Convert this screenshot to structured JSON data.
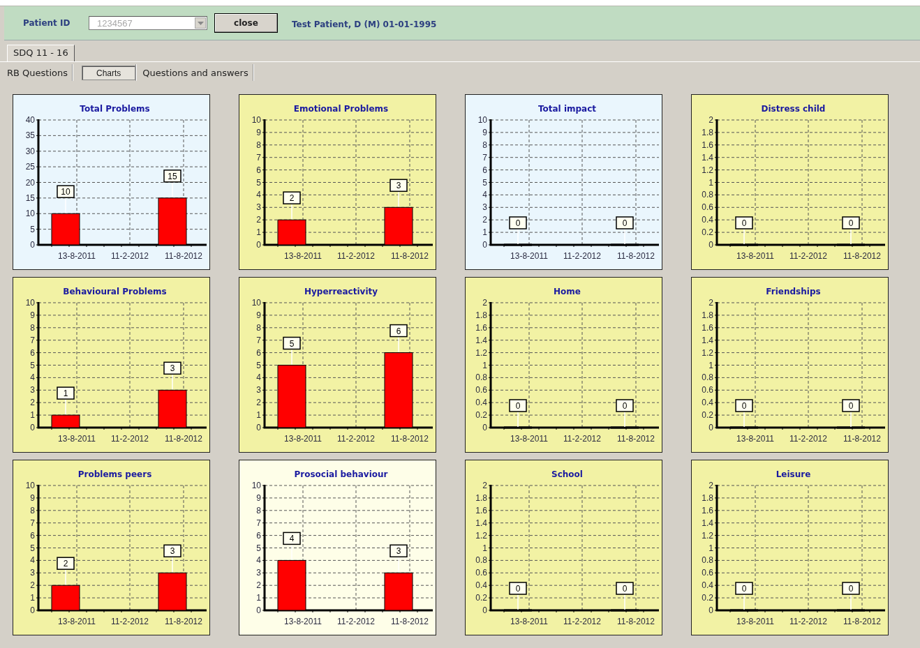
{
  "header": {
    "patient_id_label": "Patient ID",
    "patient_id": {
      "value": "1234567",
      "disabled": true
    },
    "close_button": "close",
    "patient_info": "Test Patient, D (M) 01-01-1995"
  },
  "tabs": [
    {
      "label": "SDQ 11 - 16",
      "selected": true
    }
  ],
  "subtabs": [
    {
      "label": "RB Questions",
      "selected": false
    },
    {
      "label": "Charts",
      "selected": true
    },
    {
      "label": "Questions and answers",
      "selected": false
    }
  ],
  "charts": [
    {
      "color": "#eaf6fd",
      "chart_data": {
        "type": "bar",
        "title": "Total Problems",
        "categories": [
          "13-8-2011",
          "11-2-2012",
          "11-8-2012"
        ],
        "series": [
          {
            "color": "#ff0000",
            "values": [
              10,
              null,
              15
            ]
          }
        ],
        "ylim": [
          0,
          40
        ],
        "yticks": [
          0,
          5,
          10,
          15,
          20,
          25,
          30,
          35,
          40
        ],
        "grid": true,
        "data_labels": true
      }
    },
    {
      "color": "#f2f2a4",
      "chart_data": {
        "type": "bar",
        "title": "Emotional Problems",
        "categories": [
          "13-8-2011",
          "11-2-2012",
          "11-8-2012"
        ],
        "series": [
          {
            "color": "#ff0000",
            "values": [
              2,
              null,
              3
            ]
          }
        ],
        "ylim": [
          0,
          10
        ],
        "yticks": [
          0,
          1,
          2,
          3,
          4,
          5,
          6,
          7,
          8,
          9,
          10
        ],
        "grid": true,
        "data_labels": true
      }
    },
    {
      "color": "#eaf6fd",
      "chart_data": {
        "type": "bar",
        "title": "Total impact",
        "categories": [
          "13-8-2011",
          "11-2-2012",
          "11-8-2012"
        ],
        "series": [
          {
            "values": [
              0,
              null,
              0
            ]
          }
        ],
        "ylim": [
          0,
          10
        ],
        "yticks": [
          0,
          1,
          2,
          3,
          4,
          5,
          6,
          7,
          8,
          9,
          10
        ],
        "grid": true,
        "data_labels": true
      }
    },
    {
      "color": "#f2f2a4",
      "chart_data": {
        "type": "bar",
        "title": "Distress child",
        "categories": [
          "13-8-2011",
          "11-2-2012",
          "11-8-2012"
        ],
        "series": [
          {
            "values": [
              0,
              null,
              0
            ]
          }
        ],
        "ylim": [
          0,
          2
        ],
        "yticks": [
          0,
          0.2,
          0.4,
          0.6,
          0.8,
          1,
          1.2,
          1.4,
          1.6,
          1.8,
          2
        ],
        "grid": true,
        "data_labels": true
      }
    },
    {
      "color": "#f2f2a4",
      "chart_data": {
        "type": "bar",
        "title": "Behavioural Problems",
        "categories": [
          "13-8-2011",
          "11-2-2012",
          "11-8-2012"
        ],
        "series": [
          {
            "color": "#ff0000",
            "values": [
              1,
              null,
              3
            ]
          }
        ],
        "ylim": [
          0,
          10
        ],
        "yticks": [
          0,
          1,
          2,
          3,
          4,
          5,
          6,
          7,
          8,
          9,
          10
        ],
        "grid": true,
        "data_labels": true
      }
    },
    {
      "color": "#f2f2a4",
      "chart_data": {
        "type": "bar",
        "title": "Hyperreactivity",
        "categories": [
          "13-8-2011",
          "11-2-2012",
          "11-8-2012"
        ],
        "series": [
          {
            "color": "#ff0000",
            "values": [
              5,
              null,
              6
            ]
          }
        ],
        "ylim": [
          0,
          10
        ],
        "yticks": [
          0,
          1,
          2,
          3,
          4,
          5,
          6,
          7,
          8,
          9,
          10
        ],
        "grid": true,
        "data_labels": true
      }
    },
    {
      "color": "#f2f2a4",
      "chart_data": {
        "type": "bar",
        "title": "Home",
        "categories": [
          "13-8-2011",
          "11-2-2012",
          "11-8-2012"
        ],
        "series": [
          {
            "values": [
              0,
              null,
              0
            ]
          }
        ],
        "ylim": [
          0,
          2
        ],
        "yticks": [
          0,
          0.2,
          0.4,
          0.6,
          0.8,
          1,
          1.2,
          1.4,
          1.6,
          1.8,
          2
        ],
        "grid": true,
        "data_labels": true
      }
    },
    {
      "color": "#f2f2a4",
      "chart_data": {
        "type": "bar",
        "title": "Friendships",
        "categories": [
          "13-8-2011",
          "11-2-2012",
          "11-8-2012"
        ],
        "series": [
          {
            "values": [
              0,
              null,
              0
            ]
          }
        ],
        "ylim": [
          0,
          2
        ],
        "yticks": [
          0,
          0.2,
          0.4,
          0.6,
          0.8,
          1,
          1.2,
          1.4,
          1.6,
          1.8,
          2
        ],
        "grid": true,
        "data_labels": true
      }
    },
    {
      "color": "#f2f2a4",
      "chart_data": {
        "type": "bar",
        "title": "Problems peers",
        "categories": [
          "13-8-2011",
          "11-2-2012",
          "11-8-2012"
        ],
        "series": [
          {
            "color": "#ff0000",
            "values": [
              2,
              null,
              3
            ]
          }
        ],
        "ylim": [
          0,
          10
        ],
        "yticks": [
          0,
          1,
          2,
          3,
          4,
          5,
          6,
          7,
          8,
          9,
          10
        ],
        "grid": true,
        "data_labels": true
      }
    },
    {
      "color": "#fefee8",
      "chart_data": {
        "type": "bar",
        "title": "Prosocial behaviour",
        "categories": [
          "13-8-2011",
          "11-2-2012",
          "11-8-2012"
        ],
        "series": [
          {
            "color": "#ff0000",
            "values": [
              4,
              null,
              3
            ]
          }
        ],
        "ylim": [
          0,
          10
        ],
        "yticks": [
          0,
          1,
          2,
          3,
          4,
          5,
          6,
          7,
          8,
          9,
          10
        ],
        "grid": true,
        "data_labels": true
      }
    },
    {
      "color": "#f2f2a4",
      "chart_data": {
        "type": "bar",
        "title": "School",
        "categories": [
          "13-8-2011",
          "11-2-2012",
          "11-8-2012"
        ],
        "series": [
          {
            "values": [
              0,
              null,
              0
            ]
          }
        ],
        "ylim": [
          0,
          2
        ],
        "yticks": [
          0,
          0.2,
          0.4,
          0.6,
          0.8,
          1,
          1.2,
          1.4,
          1.6,
          1.8,
          2
        ],
        "grid": true,
        "data_labels": true
      }
    },
    {
      "color": "#f2f2a4",
      "chart_data": {
        "type": "bar",
        "title": "Leisure",
        "categories": [
          "13-8-2011",
          "11-2-2012",
          "11-8-2012"
        ],
        "series": [
          {
            "values": [
              0,
              null,
              0
            ]
          }
        ],
        "ylim": [
          0,
          2
        ],
        "yticks": [
          0,
          0.2,
          0.4,
          0.6,
          0.8,
          1,
          1.2,
          1.4,
          1.6,
          1.8,
          2
        ],
        "grid": true,
        "data_labels": true
      }
    }
  ]
}
